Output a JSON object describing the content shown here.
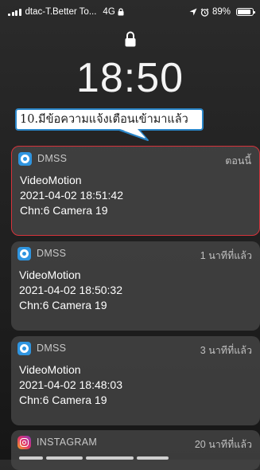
{
  "status_bar": {
    "carrier": "dtac-T.Better To...",
    "network": "4G",
    "battery": "89%",
    "battery_level": 0.89,
    "icons": [
      "signal-icon",
      "lock-icon",
      "location-arrow-icon",
      "alarm-icon",
      "battery-icon"
    ]
  },
  "lock_screen": {
    "time": "18:50"
  },
  "callout": {
    "text": "10.มีข้อความแจ้งเตือนเข้ามาแล้ว",
    "border_color": "#2a86c9"
  },
  "notifications": [
    {
      "app": "DMSS",
      "time": "ตอนนี้",
      "lines": [
        "VideoMotion",
        "2021-04-02 18:51:42",
        "Chn:6  Camera 19"
      ],
      "highlighted": true,
      "icon": "dmss-app-icon"
    },
    {
      "app": "DMSS",
      "time": "1 นาทีที่แล้ว",
      "lines": [
        "VideoMotion",
        "2021-04-02 18:50:32",
        "Chn:6  Camera 19"
      ],
      "highlighted": false,
      "icon": "dmss-app-icon"
    },
    {
      "app": "DMSS",
      "time": "3 นาทีที่แล้ว",
      "lines": [
        "VideoMotion",
        "2021-04-02 18:48:03",
        "Chn:6  Camera 19"
      ],
      "highlighted": false,
      "icon": "dmss-app-icon"
    },
    {
      "app": "INSTAGRAM",
      "time": "20 นาทีที่แล้ว",
      "lines": [],
      "highlighted": false,
      "icon": "instagram-app-icon"
    }
  ],
  "colors": {
    "highlight_border": "#d6333b",
    "dmss_blue": "#2f95e0"
  }
}
